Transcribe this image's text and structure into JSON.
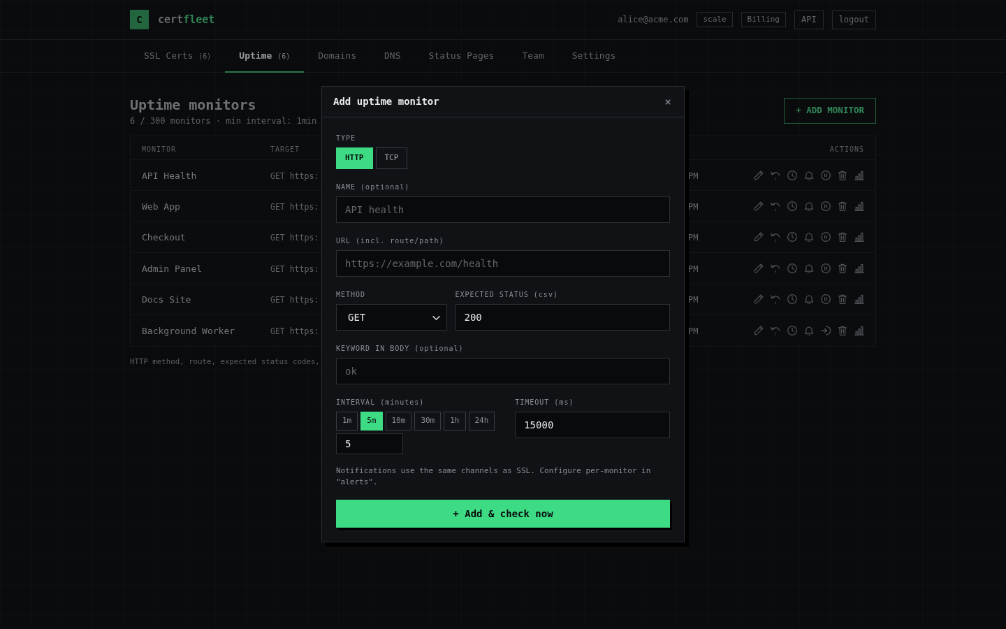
{
  "header": {
    "brand": {
      "mark": "C",
      "name": "cert",
      "accent": "fleet"
    },
    "user_email": "alice@acme.com",
    "items": [
      {
        "label": "scale",
        "kind": "tag"
      },
      {
        "label": "Billing",
        "kind": "tag"
      },
      {
        "label": "API",
        "kind": "button"
      },
      {
        "label": "logout",
        "kind": "button"
      }
    ]
  },
  "tabs": [
    {
      "label": "SSL Certs",
      "count": "(6)",
      "selected": false
    },
    {
      "label": "Uptime",
      "count": "(6)",
      "selected": true
    },
    {
      "label": "Domains",
      "selected": false
    },
    {
      "label": "DNS",
      "selected": false
    },
    {
      "label": "Status Pages",
      "selected": false
    },
    {
      "label": "Team",
      "selected": false
    },
    {
      "label": "Settings",
      "selected": false
    }
  ],
  "page": {
    "title": "Uptime monitors",
    "subtitle": "6 / 300 monitors · min interval: 1min",
    "add_button": "+ ADD MONITOR"
  },
  "table": {
    "columns": [
      "MONITOR",
      "TARGET",
      "ACTIONS"
    ],
    "rows": [
      {
        "monitor": "API Health",
        "target": "GET https:",
        "column_3": "PM",
        "paused": false
      },
      {
        "monitor": "Web App",
        "target": "GET https:",
        "column_3": "PM",
        "paused": false
      },
      {
        "monitor": "Checkout",
        "target": "GET https:",
        "column_3": "PM",
        "paused": false
      },
      {
        "monitor": "Admin Panel",
        "target": "GET https:",
        "column_3": "PM",
        "paused": false
      },
      {
        "monitor": "Docs Site",
        "target": "GET https:",
        "column_3": "PM",
        "paused": false
      },
      {
        "monitor": "Background Worker",
        "target": "GET https:",
        "column_3": "PM",
        "paused": true
      }
    ]
  },
  "footer_note": "HTTP method, route, expected status codes,",
  "modal": {
    "title": "Add uptime monitor",
    "close": "×",
    "type": {
      "label": "TYPE",
      "options": [
        {
          "label": "HTTP",
          "selected": true
        },
        {
          "label": "TCP",
          "selected": false
        }
      ]
    },
    "name": {
      "label": "NAME (optional)",
      "placeholder": "API health"
    },
    "url": {
      "label": "URL (incl. route/path)",
      "placeholder": "https://example.com/health"
    },
    "method": {
      "label": "METHOD",
      "value": "GET"
    },
    "expected_status": {
      "label": "EXPECTED STATUS (csv)",
      "value": "200"
    },
    "keyword": {
      "label": "KEYWORD IN BODY (optional)",
      "placeholder": "ok"
    },
    "interval": {
      "label": "INTERVAL (minutes)",
      "presets": [
        {
          "label": "1m",
          "selected": false
        },
        {
          "label": "5m",
          "selected": true
        },
        {
          "label": "10m",
          "selected": false
        },
        {
          "label": "30m",
          "selected": false
        },
        {
          "label": "1h",
          "selected": false
        },
        {
          "label": "24h",
          "selected": false
        }
      ],
      "value": "5"
    },
    "timeout": {
      "label": "TIMEOUT (ms)",
      "value": "15000"
    },
    "note": "Notifications use the same channels as SSL. Configure per-monitor in \"alerts\".",
    "submit": "+ Add & check now"
  }
}
